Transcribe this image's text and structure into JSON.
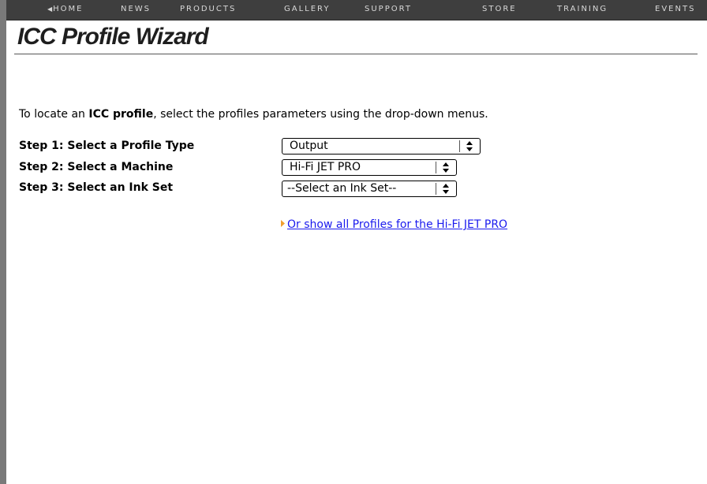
{
  "nav": {
    "items": [
      {
        "label": "HOME",
        "has_arrow": true
      },
      {
        "label": "NEWS"
      },
      {
        "label": "PRODUCTS"
      },
      {
        "label": "GALLERY"
      },
      {
        "label": "SUPPORT"
      },
      {
        "label": "STORE"
      },
      {
        "label": "TRAINING"
      },
      {
        "label": "EVENTS"
      }
    ]
  },
  "page": {
    "title": "ICC Profile Wizard"
  },
  "intro": {
    "prefix": "To locate an ",
    "bold": "ICC profile",
    "suffix": ", select the profiles parameters using the drop-down menus."
  },
  "steps": [
    {
      "label": "Step 1: Select a Profile Type",
      "selected": "Output"
    },
    {
      "label": "Step 2: Select a Machine",
      "selected": "Hi-Fi JET PRO"
    },
    {
      "label": "Step 3: Select an Ink Set",
      "selected": "--Select an Ink Set--"
    }
  ],
  "show_all_link": "Or show all Profiles for the Hi-Fi JET PRO",
  "colors": {
    "nav_background": "#3e3e3e",
    "nav_text": "#d8d8d8",
    "link": "#1a1aee",
    "bullet_arrow": "#f0a030"
  }
}
